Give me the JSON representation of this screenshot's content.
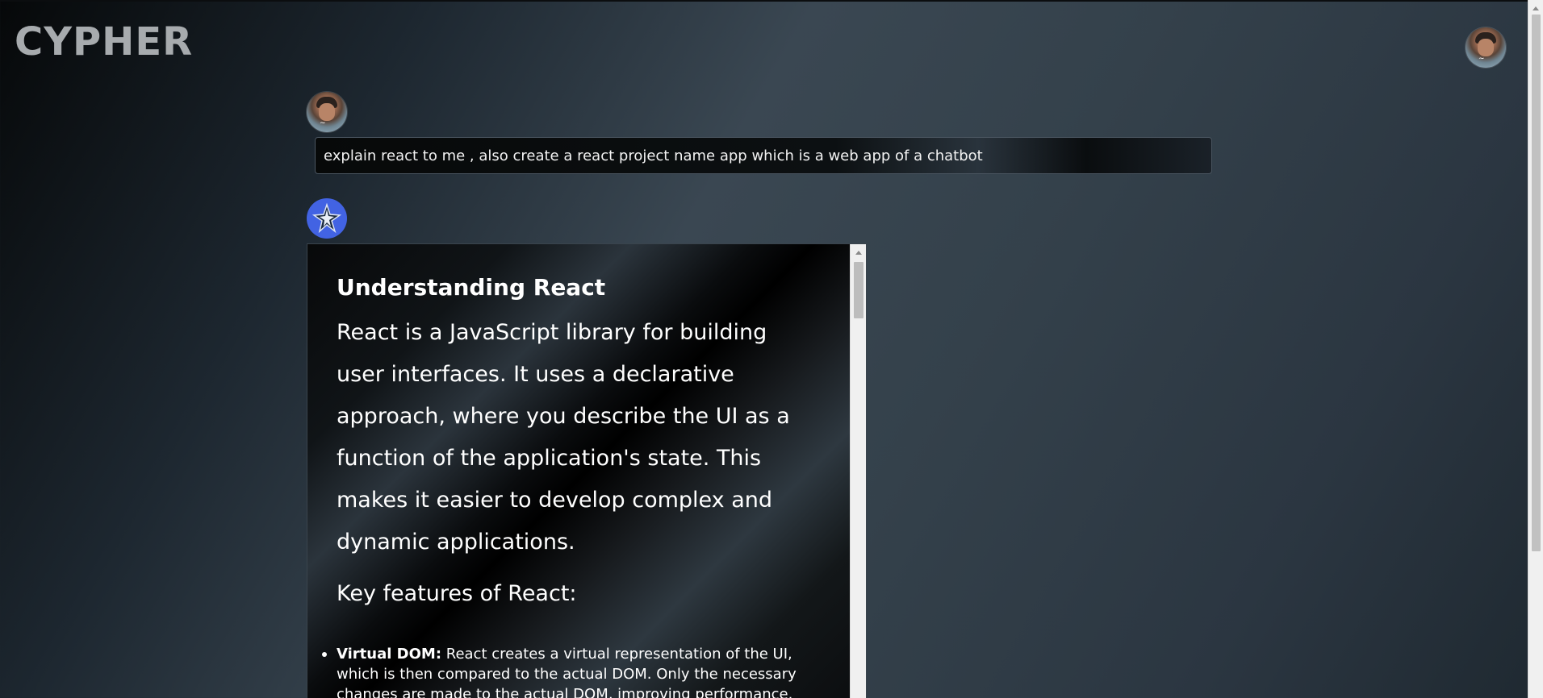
{
  "app": {
    "brand": "CYPHER"
  },
  "header": {
    "profile_icon": "user-avatar-icon"
  },
  "conversation": {
    "user_message": {
      "avatar_icon": "user-avatar-icon",
      "text": "explain react to me , also create a react project name app which is a web app of a chatbot"
    },
    "bot_message": {
      "avatar_icon": "bot-logo-icon",
      "title": "Understanding React",
      "paragraph": "React is a JavaScript library for building user interfaces. It uses a declarative approach, where you describe the UI as a function of the application's state. This makes it easier to develop complex and dynamic applications.",
      "subheading": "Key features of React:",
      "features": [
        {
          "term": "Virtual DOM:",
          "description": " React creates a virtual representation of the UI, which is then compared to the actual DOM. Only the necessary changes are made to the actual DOM, improving performance."
        }
      ]
    }
  },
  "colors": {
    "bot_avatar_bg": "#4263e3",
    "brand_text": "#a7abae"
  }
}
